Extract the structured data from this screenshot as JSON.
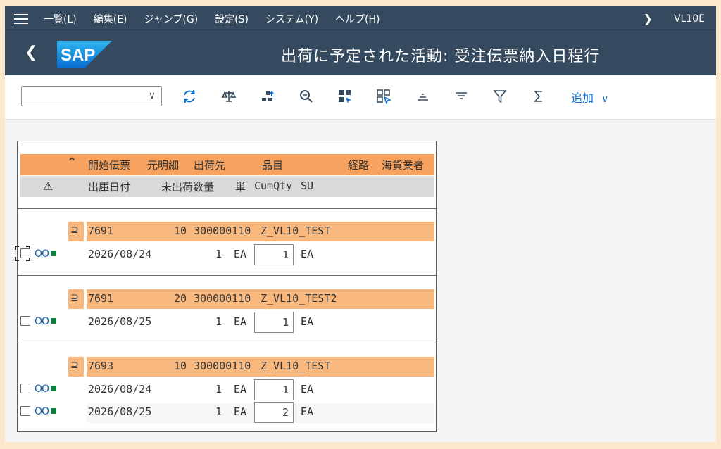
{
  "menubar": {
    "items": [
      "一覧(L)",
      "編集(E)",
      "ジャンプ(G)",
      "設定(S)",
      "システム(Y)",
      "ヘルプ(H)"
    ],
    "tcode": "VL10E"
  },
  "titlebar": {
    "logo_text": "SAP",
    "title": "出荷に予定された活動: 受注伝票納入日程行"
  },
  "toolbar": {
    "layout_select_value": "",
    "buttons": [
      "refresh",
      "balance",
      "hierarchy",
      "zoom",
      "select-all",
      "deselect-all",
      "sort-ascending",
      "sort-descending",
      "filter",
      "sum"
    ],
    "add_label": "追加"
  },
  "grid": {
    "header1": {
      "col_doc": "開始伝票",
      "col_item": "元明細",
      "col_shipto": "出荷先",
      "col_material": "品目",
      "col_route": "経路",
      "col_forwarder": "海貨業者"
    },
    "header2": {
      "warn": "⚠",
      "col_date": "出庫日付",
      "col_openqty": "未出荷数量",
      "col_unit": "単",
      "col_cumqty": "CumQty",
      "col_su": "SU"
    },
    "groups": [
      {
        "doc": "7691",
        "item": "10",
        "shipto": "300000110",
        "material": "Z_VL10_TEST",
        "lines": [
          {
            "date": "2026/08/24",
            "qty": "1",
            "unit": "EA",
            "cumqty": "1",
            "su": "EA"
          }
        ]
      },
      {
        "doc": "7691",
        "item": "20",
        "shipto": "300000110",
        "material": "Z_VL10_TEST2",
        "lines": [
          {
            "date": "2026/08/25",
            "qty": "1",
            "unit": "EA",
            "cumqty": "1",
            "su": "EA"
          }
        ]
      },
      {
        "doc": "7693",
        "item": "10",
        "shipto": "300000110",
        "material": "Z_VL10_TEST",
        "lines": [
          {
            "date": "2026/08/24",
            "qty": "1",
            "unit": "EA",
            "cumqty": "1",
            "su": "EA"
          },
          {
            "date": "2026/08/25",
            "qty": "1",
            "unit": "EA",
            "cumqty": "2",
            "su": "EA"
          }
        ]
      }
    ],
    "light_glyph": "OO"
  },
  "colors": {
    "shell": "#354a5f",
    "header_orange": "#f7a35f",
    "group_orange": "#f8b87d",
    "accent_blue": "#0a6ed1",
    "status_green": "#107e3e"
  }
}
